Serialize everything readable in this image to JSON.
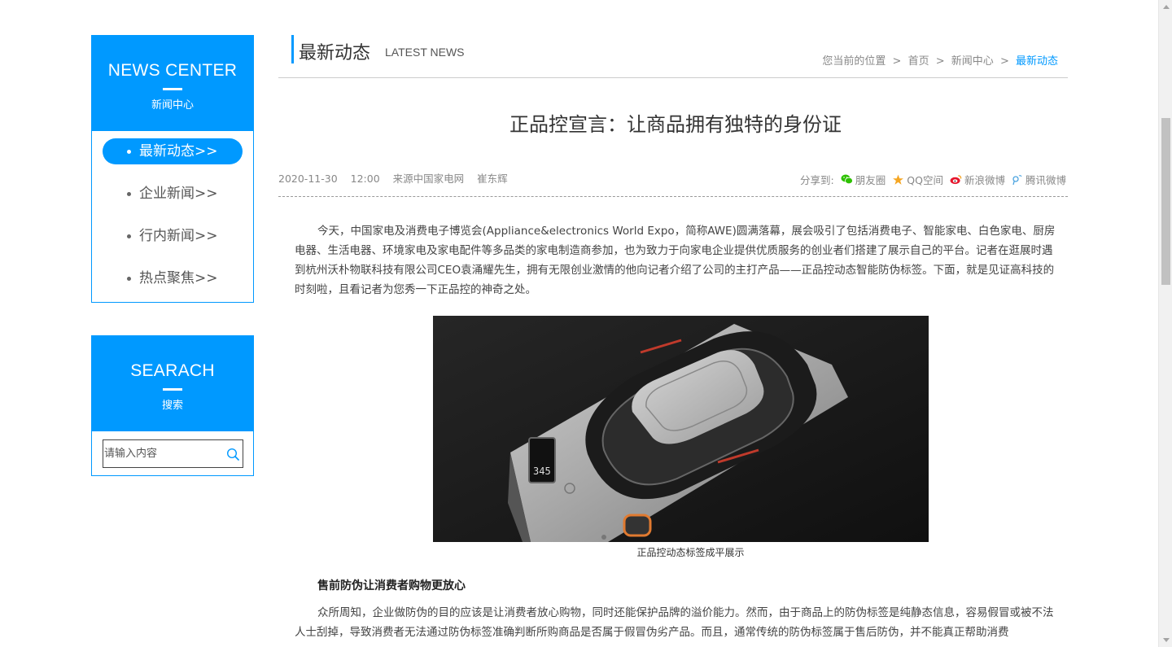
{
  "sidebar": {
    "news": {
      "title_en": "NEWS CENTER",
      "title_cn": "新闻中心",
      "items": [
        {
          "label": "最新动态>>"
        },
        {
          "label": "企业新闻>>"
        },
        {
          "label": "行内新闻>>"
        },
        {
          "label": "热点聚焦>>"
        }
      ]
    },
    "search": {
      "title_en": "SEARACH",
      "title_cn": "搜索",
      "placeholder": "请输入内容"
    }
  },
  "section": {
    "title_cn": "最新动态",
    "title_en": "LATEST NEWS"
  },
  "breadcrumb": {
    "prefix": "您当前的位置",
    "sep": ">",
    "items": [
      "首页",
      "新闻中心",
      "最新动态"
    ]
  },
  "article": {
    "title": "正品控宣言：让商品拥有独特的身份证",
    "date": "2020-11-30",
    "time": "12:00",
    "source": "来源中国家电网",
    "author": "崔东辉",
    "share_label": "分享到:",
    "share": [
      {
        "label": "朋友圈",
        "icon": "wechat-icon",
        "color": "#2dc100"
      },
      {
        "label": "QQ空间",
        "icon": "qzone-star-icon",
        "color": "#f5a623"
      },
      {
        "label": "新浪微博",
        "icon": "weibo-icon",
        "color": "#e6162d"
      },
      {
        "label": "腾讯微博",
        "icon": "tencent-weibo-icon",
        "color": "#4aa3e0"
      }
    ],
    "para1": "今天，中国家电及消费电子博览会(Appliance&electronics World Expo，简称AWE)圆满落幕，展会吸引了包括消费电子、智能家电、白色家电、厨房电器、生活电器、环境家电及家电配件等多品类的家电制造商参加，也为致力于向家电企业提供优质服务的创业者们搭建了展示自己的平台。记者在逛展时遇到杭州沃朴物联科技有限公司CEO袁涌耀先生，拥有无限创业激情的他向记者介绍了公司的主打产品——正品控动态智能防伪标签。下面，就是见证高科技的时刻啦，且看记者为您秀一下正品控的神奇之处。",
    "photo_screen": "345",
    "caption": "正品控动态标签成平展示",
    "subhead": "售前防伪让消费者购物更放心",
    "para2": "众所周知，企业做防伪的目的应该是让消费者放心购物，同时还能保护品牌的溢价能力。然而，由于商品上的防伪标签是纯静态信息，容易假冒或被不法人士刮掉，导致消费者无法通过防伪标签准确判断所购商品是否属于假冒伪劣产品。而且，通常传统的防伪标签属于售后防伪，并不能真正帮助消费"
  },
  "colors": {
    "accent": "#0099ff",
    "text": "#333333",
    "muted": "#888888"
  }
}
